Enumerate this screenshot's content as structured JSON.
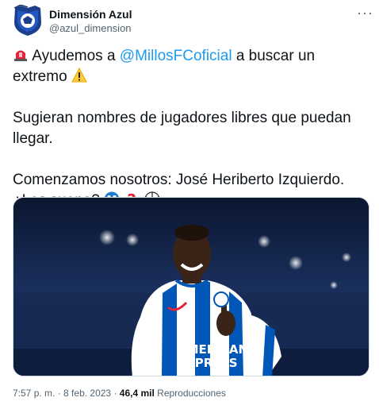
{
  "account": {
    "display_name": "Dimensión Azul",
    "handle": "@azul_dimension"
  },
  "tweet": {
    "line1_a": "Ayudemos a ",
    "mention": "@MillosFCoficial",
    "line1_b": " a buscar un extremo",
    "para2": "Sugieran nombres de jugadores libres que puedan llegar.",
    "para3_a": "Comenzamos nosotros: José Heriberto Izquierdo.",
    "para3_b": "¿Les suena?"
  },
  "media": {
    "jersey_sponsor_1": "AMERICAN",
    "jersey_sponsor_2": "EXPRESS"
  },
  "meta": {
    "time": "7:57 p. m.",
    "sep": " · ",
    "date": "8 feb. 2023",
    "views": "46,4 mil",
    "views_label": " Reproducciones"
  },
  "icons": {
    "more": "more-options-icon",
    "siren": "siren-icon",
    "warning": "warning-icon",
    "millonarios": "millonarios-logo-icon",
    "question": "red-question-icon",
    "ball": "soccer-ball-icon"
  },
  "colors": {
    "link": "#1d9bf0",
    "text": "#0f1419",
    "muted": "#536471"
  }
}
